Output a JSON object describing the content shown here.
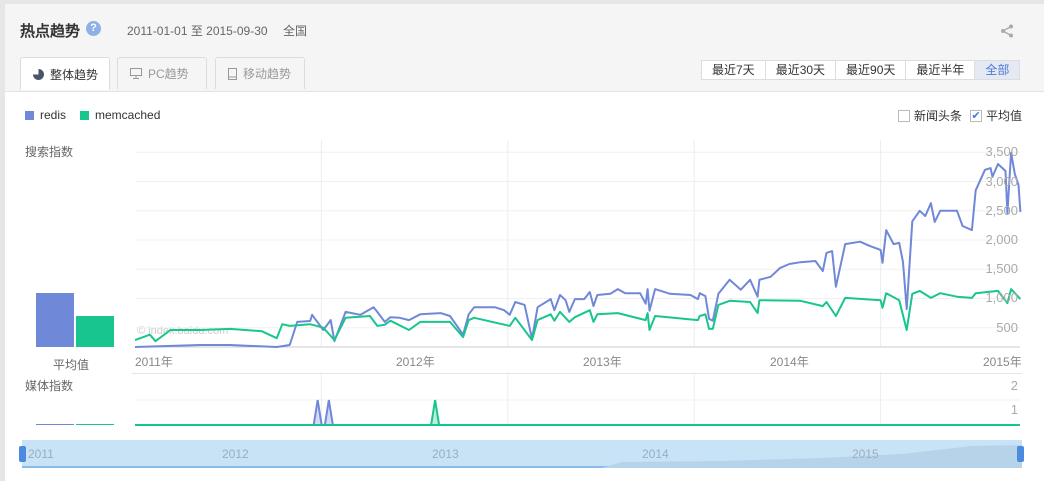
{
  "header": {
    "title": "热点趋势",
    "help_icon": "question-icon",
    "date_range": "2011-01-01 至 2015-09-30",
    "region": "全国",
    "share_icon": "share-icon"
  },
  "tabs": [
    {
      "label": "整体趋势",
      "icon": "pie-icon",
      "active": true
    },
    {
      "label": "PC趋势",
      "icon": "monitor-icon"
    },
    {
      "label": "移动趋势",
      "icon": "mobile-icon"
    }
  ],
  "periods": [
    "最近7天",
    "最近30天",
    "最近90天",
    "最近半年",
    "全部"
  ],
  "selected_period": "全部",
  "legend": [
    {
      "name": "redis",
      "color": "#6f88d8"
    },
    {
      "name": "memcached",
      "color": "#19c58f"
    }
  ],
  "options": {
    "news": {
      "label": "新闻头条",
      "checked": false
    },
    "average": {
      "label": "平均值",
      "checked": true,
      "mark": "✔"
    }
  },
  "search_label": "搜索指数",
  "media_label": "媒体指数",
  "average_label": "平均值",
  "watermark": "© index.baidu.com",
  "chart_data": [
    {
      "type": "line",
      "title": "搜索指数",
      "ylim": [
        170,
        3710
      ],
      "yticks": [
        "500",
        "1,000",
        "1,500",
        "2,000",
        "2,500",
        "3,000",
        "3,500"
      ],
      "ytick_values": [
        500,
        1000,
        1500,
        2000,
        2500,
        3000,
        3500
      ],
      "xlabels": [
        "2011年",
        "2012年",
        "2013年",
        "2014年",
        "2015年"
      ],
      "grid": true,
      "averages": {
        "redis": 1090,
        "memcached": 700
      },
      "series": [
        {
          "name": "redis",
          "x": [
            2011.0,
            2011.35,
            2011.51,
            2011.76,
            2011.83,
            2011.87,
            2011.94,
            2011.95,
            2012.01,
            2012.05,
            2012.07,
            2012.13,
            2012.21,
            2012.28,
            2012.3,
            2012.34,
            2012.37,
            2012.42,
            2012.47,
            2012.53,
            2012.64,
            2012.69,
            2012.76,
            2012.79,
            2012.82,
            2012.93,
            2012.98,
            2013.01,
            2013.04,
            2013.09,
            2013.13,
            2013.16,
            2013.23,
            2013.25,
            2013.28,
            2013.31,
            2013.33,
            2013.36,
            2013.41,
            2013.44,
            2013.46,
            2013.48,
            2013.55,
            2013.59,
            2013.63,
            2013.71,
            2013.74,
            2013.75,
            2013.76,
            2013.79,
            2013.87,
            2013.98,
            2014.02,
            2014.03,
            2014.06,
            2014.08,
            2014.1,
            2014.13,
            2014.19,
            2014.25,
            2014.3,
            2014.34,
            2014.35,
            2014.41,
            2014.46,
            2014.51,
            2014.57,
            2014.65,
            2014.69,
            2014.71,
            2014.74,
            2014.76,
            2014.81,
            2014.89,
            2014.94,
            2015.0,
            2015.01,
            2015.03,
            2015.07,
            2015.1,
            2015.12,
            2015.14,
            2015.17,
            2015.21,
            2015.24,
            2015.27,
            2015.29,
            2015.32,
            2015.41,
            2015.44,
            2015.49,
            2015.51,
            2015.56,
            2015.59,
            2015.6,
            2015.63,
            2015.67,
            2015.68,
            2015.7,
            2015.72,
            2015.74,
            2015.75
          ],
          "values": [
            170,
            205,
            205,
            170,
            205,
            600,
            615,
            720,
            460,
            630,
            270,
            770,
            720,
            850,
            770,
            600,
            680,
            670,
            630,
            730,
            750,
            700,
            380,
            730,
            850,
            850,
            800,
            720,
            940,
            890,
            310,
            850,
            990,
            800,
            1060,
            970,
            770,
            990,
            990,
            1110,
            870,
            1060,
            1080,
            1160,
            1090,
            1090,
            910,
            1160,
            790,
            1160,
            1080,
            1060,
            990,
            1090,
            1040,
            650,
            620,
            1080,
            1320,
            1150,
            1320,
            1030,
            1320,
            1370,
            1520,
            1590,
            1620,
            1640,
            1470,
            1780,
            1810,
            1200,
            1930,
            1970,
            1900,
            1830,
            1610,
            2170,
            1930,
            1950,
            1620,
            820,
            2320,
            2500,
            2410,
            2630,
            2310,
            2500,
            2500,
            2240,
            2170,
            2850,
            3200,
            3230,
            3080,
            3300,
            3180,
            2460,
            3490,
            3130,
            2940,
            2480
          ]
        },
        {
          "name": "memcached",
          "x": [
            2011.0,
            2011.08,
            2011.11,
            2011.19,
            2011.35,
            2011.51,
            2011.68,
            2011.76,
            2011.79,
            2011.83,
            2011.94,
            2012.01,
            2012.07,
            2012.13,
            2012.26,
            2012.3,
            2012.34,
            2012.37,
            2012.47,
            2012.53,
            2012.69,
            2012.76,
            2012.79,
            2012.82,
            2013.01,
            2013.04,
            2013.13,
            2013.16,
            2013.23,
            2013.25,
            2013.28,
            2013.33,
            2013.36,
            2013.44,
            2013.46,
            2013.48,
            2013.59,
            2013.74,
            2013.75,
            2013.76,
            2013.79,
            2014.02,
            2014.03,
            2014.06,
            2014.08,
            2014.1,
            2014.13,
            2014.19,
            2014.3,
            2014.34,
            2014.35,
            2014.57,
            2014.69,
            2014.71,
            2014.76,
            2014.81,
            2015.0,
            2015.01,
            2015.03,
            2015.1,
            2015.14,
            2015.17,
            2015.21,
            2015.27,
            2015.32,
            2015.41,
            2015.49,
            2015.51,
            2015.63,
            2015.68,
            2015.7,
            2015.75
          ],
          "values": [
            290,
            380,
            270,
            460,
            460,
            480,
            440,
            320,
            560,
            530,
            560,
            500,
            290,
            670,
            700,
            530,
            550,
            620,
            460,
            600,
            600,
            340,
            630,
            670,
            530,
            670,
            290,
            630,
            730,
            620,
            770,
            600,
            680,
            800,
            600,
            730,
            750,
            630,
            750,
            460,
            700,
            630,
            700,
            730,
            480,
            480,
            890,
            960,
            940,
            750,
            970,
            960,
            870,
            940,
            700,
            1010,
            970,
            840,
            1090,
            970,
            460,
            1080,
            1130,
            1010,
            1090,
            1030,
            1010,
            1090,
            1130,
            920,
            1160,
            990
          ]
        }
      ]
    },
    {
      "type": "line",
      "title": "媒体指数",
      "ylim": [
        0,
        2
      ],
      "yticks": [
        "2",
        "1"
      ],
      "ytick_values": [
        2,
        1
      ],
      "series": [
        {
          "name": "redis",
          "spikes": [
            2011.98,
            2012.04
          ],
          "value": 1
        },
        {
          "name": "memcached",
          "spikes": [
            2012.61
          ],
          "value": 1
        }
      ]
    }
  ],
  "navigator": {
    "labels": [
      "2011",
      "2012",
      "2013",
      "2014",
      "2015"
    ]
  }
}
